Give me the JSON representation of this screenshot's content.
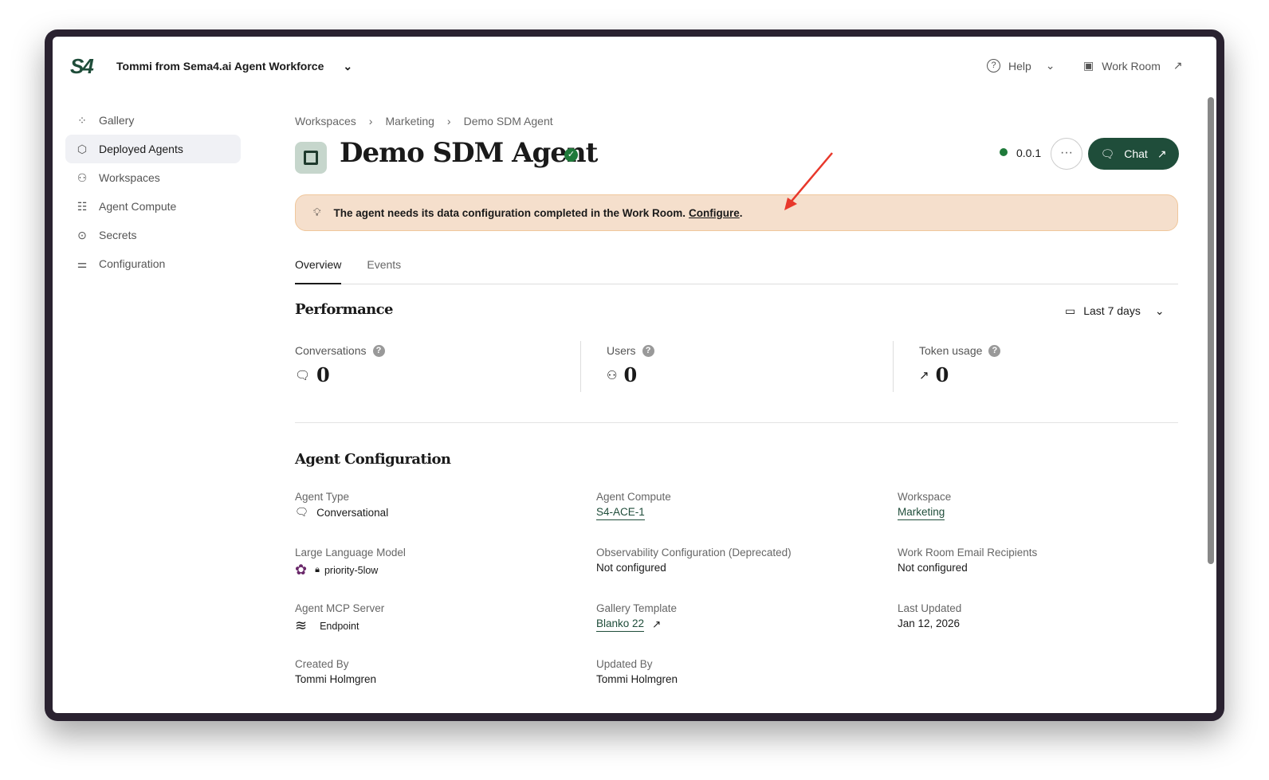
{
  "header": {
    "logo": "S4",
    "workspace_title": "Tommi from Sema4.ai Agent Workforce",
    "help": "Help",
    "work_room": "Work Room"
  },
  "sidebar": {
    "items": [
      {
        "label": "Gallery"
      },
      {
        "label": "Deployed Agents"
      },
      {
        "label": "Workspaces"
      },
      {
        "label": "Agent Compute"
      },
      {
        "label": "Secrets"
      },
      {
        "label": "Configuration"
      }
    ]
  },
  "breadcrumb": [
    "Workspaces",
    "Marketing",
    "Demo SDM Agent"
  ],
  "agent": {
    "name": "Demo SDM Agent",
    "version": "0.0.1",
    "chat_label": "Chat",
    "status_color": "#1f7a3a"
  },
  "banner": {
    "text": "The agent needs its data configuration completed in the Work Room.",
    "link": "Configure",
    "suffix": "."
  },
  "tabs": [
    "Overview",
    "Events"
  ],
  "performance": {
    "title": "Performance",
    "range": "Last 7 days",
    "metrics": [
      {
        "label": "Conversations",
        "value": "0"
      },
      {
        "label": "Users",
        "value": "0"
      },
      {
        "label": "Token usage",
        "value": "0"
      }
    ]
  },
  "config": {
    "title": "Agent Configuration",
    "agent_type_label": "Agent Type",
    "agent_type": "Conversational",
    "compute_label": "Agent Compute",
    "compute": "S4-ACE-1",
    "workspace_label": "Workspace",
    "workspace": "Marketing",
    "llm_label": "Large Language Model",
    "llm": "priority-5low",
    "obs_label": "Observability Configuration (Deprecated)",
    "obs": "Not configured",
    "email_label": "Work Room Email Recipients",
    "email": "Not configured",
    "mcp_label": "Agent MCP Server",
    "mcp": "Endpoint",
    "template_label": "Gallery Template",
    "template": "Blanko 22",
    "updated_label": "Last Updated",
    "updated": "Jan 12, 2026",
    "created_by_label": "Created By",
    "created_by": "Tommi Holmgren",
    "updated_by_label": "Updated By",
    "updated_by": "Tommi Holmgren"
  },
  "colors": {
    "brand": "#1f4d3a",
    "banner": "#f5dfcc",
    "annotation": "#e8382b"
  }
}
